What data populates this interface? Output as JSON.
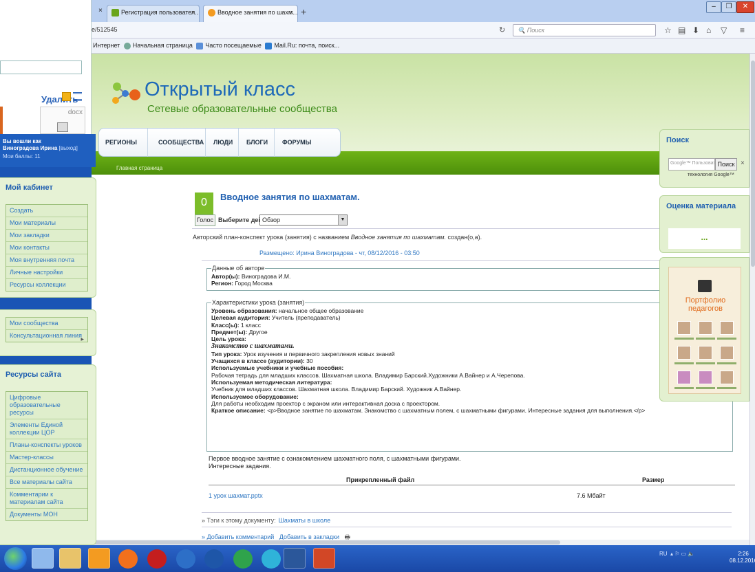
{
  "left_window": {
    "delete_label": "Удалить",
    "doc_ext": "docx"
  },
  "browser": {
    "tabs": [
      {
        "label": "Регистрация пользовател...",
        "close": "×"
      },
      {
        "label": "Вводное занятия по шахм...",
        "close": "×"
      }
    ],
    "first_tab_close": "×",
    "new_tab": "+",
    "url": "e/512545",
    "search_placeholder": "Поиск",
    "bookmarks": [
      "Интернет",
      "Начальная страница",
      "Часто посещаемые",
      "Mail.Ru: почта, поиск..."
    ]
  },
  "site": {
    "logo_title": "Открытый класс",
    "logo_subtitle": "Сетевые образовательные сообщества",
    "nav": [
      "РЕГИОНЫ",
      "СООБЩЕСТВА",
      "ЛЮДИ",
      "БЛОГИ",
      "ФОРУМЫ"
    ],
    "breadcrumb": "Главная страница",
    "user": {
      "line1": "Вы вошли как",
      "name": "Виноградова Ирина",
      "logout": "[выход]",
      "points": "Мои баллы: 11"
    },
    "cabinet": {
      "title": "Мой кабинет",
      "items": [
        "Создать",
        "Мои материалы",
        "Мои закладки",
        "Мои контакты",
        "Моя внутренняя почта",
        "Личные настройки",
        "Ресурсы коллекции"
      ]
    },
    "communities": {
      "items": [
        "Мои сообщества",
        "Консультационная линия"
      ]
    },
    "resources": {
      "title": "Ресурсы сайта",
      "items": [
        "Цифровые образовательные ресурсы",
        "Элементы Единой коллекции ЦОР",
        "Планы-конспекты уроков",
        "Мастер-классы",
        "Дистанционное обучение",
        "Все материалы сайта",
        "Комментарии к материалам сайта",
        "Документы МОН"
      ]
    },
    "search": {
      "title": "Поиск",
      "placeholder": "Google™ Пользовательский",
      "button": "Поиск",
      "clear": "×",
      "tech": "технология Google™"
    },
    "rating": {
      "title": "Оценка материала",
      "value": "..."
    },
    "banner": {
      "text": "Портфолио педагогов"
    }
  },
  "content": {
    "vote_count": "0",
    "vote_button": "Голос",
    "title": "Вводное занятия по шахматам.",
    "action_label": "Выберите действие:",
    "action_value": "Обзор",
    "intro_prefix": "Авторский план-конспект урока (занятия) с названием",
    "intro_title": "Вводное занятия по шахматам.",
    "intro_suffix": "создан(о,а).",
    "posted": "Размещено: Ирина Виноградова - чт, 08/12/2016 - 03:50",
    "author_legend": "Данные об авторе",
    "author_label": "Автор(ы):",
    "author": "Виноградова И.М.",
    "region_label": "Регион:",
    "region": "Город Москва",
    "chars_legend": "Характеристики урока (занятия)",
    "level_label": "Уровень образования:",
    "level": "начальное общее образование",
    "audience_label": "Целевая аудитория:",
    "audience": "Учитель (преподаватель)",
    "class_label": "Класс(ы):",
    "class": "1 класс",
    "subject_label": "Предмет(ы):",
    "subject": "Другое",
    "goal_label": "Цель урока:",
    "goal": "Знакомство с шахматами.",
    "type_label": "Тип урока:",
    "type": "Урок изучения и первичного закрепления новых знаний",
    "students_label": "Учащихся в классе (аудитории):",
    "students": "30",
    "books_label": "Используемые учебники и учебные пособия:",
    "books": "Рабочая тетрадь для младших классов. Шахматная школа. Владимир Барский.Художники А.Вайнер и А.Черепова.",
    "lit_label": "Используемая методическая литература:",
    "lit": "Учебник для младших классов. Шахматная школа. Владимир Барский. Художник А.Вайнер.",
    "equip_label": "Используемое оборудование:",
    "equip": "Для работы необходим проектор с экраном или интерактивная доска с проектором.",
    "desc_label": "Краткое описание:",
    "desc": "<p>Вводное занятие по шахматам. Знакомство с шахматным полем, с шахматными фигурами. Интересные задания для выполнения.</p>",
    "first_text_1": "Первое вводное занятие с ознакомлением шахматного поля, с шахматными фигурами.",
    "first_text_2": "Интересные задания.",
    "file_col": "Прикрепленный файл",
    "size_col": "Размер",
    "file_name": "1 урок шахмат.pptx",
    "file_size": "7.6 Мбайт",
    "tags_label": "» Тэги к этому документу:",
    "tag": "Шахматы в школе",
    "add_comment": "» Добавить комментарий",
    "add_bookmark": "Добавить в закладки"
  },
  "taskbar": {
    "lang": "RU",
    "time": "2:26",
    "date": "08.12.2016"
  }
}
